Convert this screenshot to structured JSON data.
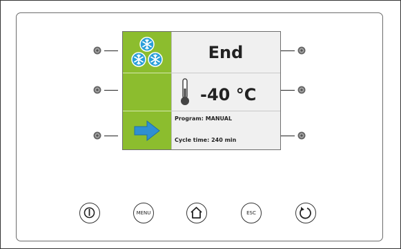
{
  "display": {
    "status": "End",
    "temperature": "-40 °C",
    "program": "Program: MANUAL",
    "cycle_time": "Cycle time: 240 min"
  },
  "buttons": {
    "menu_label": "MENU",
    "esc_label": "ESC"
  },
  "icons": {
    "frost": "snowflake-cluster-icon",
    "thermometer": "thermometer-icon",
    "arrow": "arrow-right-icon",
    "power": "power-icon",
    "home": "home-icon",
    "cycle": "cycle-icon"
  },
  "colors": {
    "accent_green": "#8cbd2e",
    "snowflake_blue": "#2a9fd8",
    "arrow_blue": "#2f8fd2"
  }
}
